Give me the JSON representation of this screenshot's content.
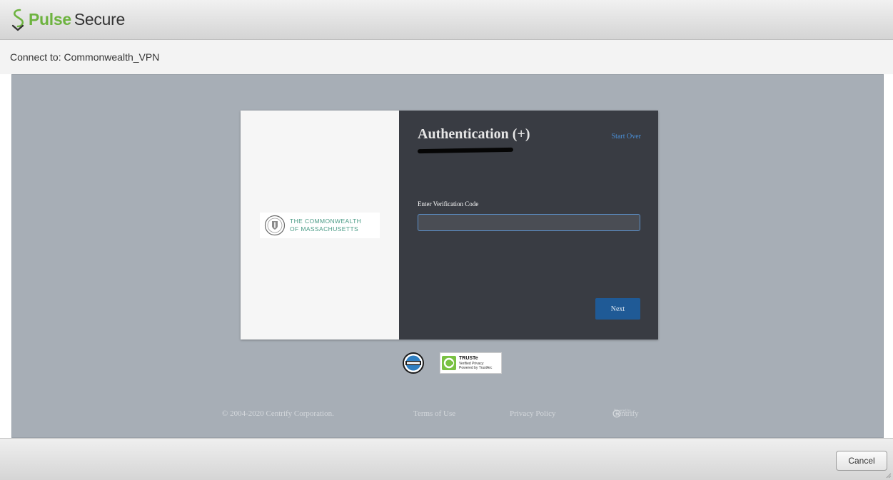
{
  "window": {
    "brand_primary": "Pulse",
    "brand_secondary": "Secure",
    "brand_color": "#6db33f",
    "logo_icon": "pulse-secure-logo-icon"
  },
  "connection": {
    "label": "Connect to: Commonwealth_VPN"
  },
  "auth_card": {
    "org_logo_line1": "THE COMMONWEALTH",
    "org_logo_line2": "OF MASSACHUSETTS",
    "title": "Authentication (+)",
    "start_over": "Start Over",
    "field_label": "Enter Verification Code",
    "field_value": "",
    "next_label": "Next",
    "accent_color": "#1f5a96",
    "panel_color": "#393c43"
  },
  "badges": {
    "truste_title": "TRUSTe",
    "truste_line1": "Verified Privacy",
    "truste_line2": "Powered by TrustArc"
  },
  "footer": {
    "copyright": "© 2004-2020 Centrify Corporation.",
    "terms": "Terms of Use",
    "privacy": "Privacy Policy",
    "powered_by": "Powered by",
    "centrify": "Centrify"
  },
  "actions": {
    "cancel_label": "Cancel"
  }
}
